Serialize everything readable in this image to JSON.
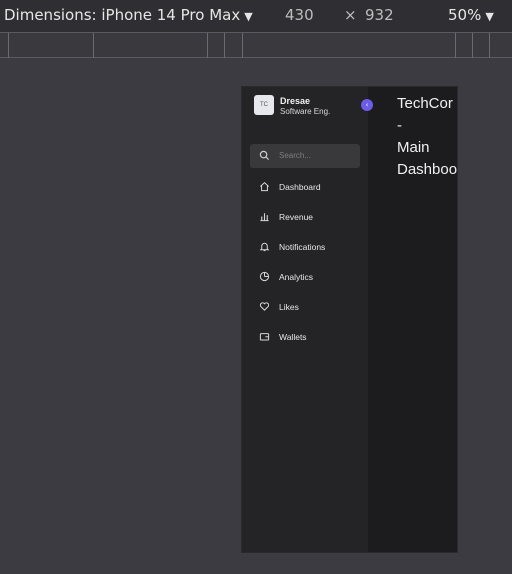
{
  "toolbar": {
    "device_label": "Dimensions: iPhone 14 Pro Max",
    "width": "430",
    "times": "×",
    "height": "932",
    "zoom": "50%"
  },
  "sidebar": {
    "avatar_initials": "TC",
    "name": "Dresae",
    "role": "Software Eng.",
    "toggle_icon": "chevron-left-icon",
    "search_placeholder": "Search...",
    "items": [
      {
        "label": "Dashboard",
        "icon": "home-icon"
      },
      {
        "label": "Revenue",
        "icon": "bar-chart-icon"
      },
      {
        "label": "Notifications",
        "icon": "bell-icon"
      },
      {
        "label": "Analytics",
        "icon": "pie-chart-icon"
      },
      {
        "label": "Likes",
        "icon": "heart-icon"
      },
      {
        "label": "Wallets",
        "icon": "wallet-icon"
      }
    ]
  },
  "main": {
    "title_line1": "TechCor",
    "title_line2": "-",
    "title_line3": "Main",
    "title_line4": "Dashboo"
  },
  "colors": {
    "accent": "#6c5ce7",
    "sidebar_bg": "#242426",
    "main_bg": "#1c1c1e"
  }
}
